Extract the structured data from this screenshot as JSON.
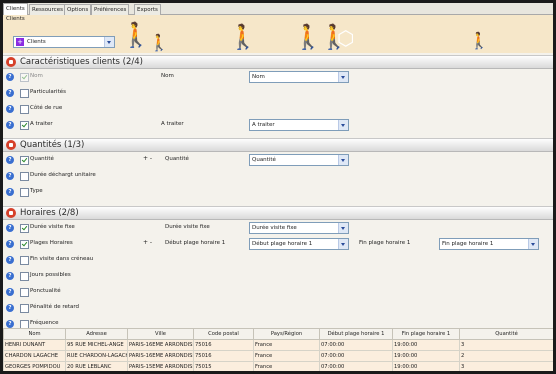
{
  "tabs": [
    {
      "label": "Clients"
    },
    {
      "label": "Ressources"
    },
    {
      "label": "Options"
    },
    {
      "label": "Préférences"
    },
    {
      "label": "Exports"
    }
  ],
  "header": {
    "label": "Clients",
    "select_value": "Clients",
    "accent": "#f0b000"
  },
  "sections": {
    "caracteristiques": "Caractéristiques clients (2/4)",
    "quantites": "Quantités (1/3)",
    "horaires": "Horaires (2/8)"
  },
  "rows": {
    "nom": {
      "label": "Nom",
      "label2": "Nom",
      "select": "Nom"
    },
    "particularites": {
      "label": "Particularités"
    },
    "cote_de_rue": {
      "label": "Côté de rue"
    },
    "a_traiter": {
      "label": "A traiter",
      "label2": "A traiter",
      "select": "A traiter"
    },
    "quantite": {
      "label": "Quantité",
      "pm": "+ -",
      "label2": "Quantité",
      "select": "Quantité"
    },
    "duree_dechargement": {
      "label": "Durée déchargt unitaire"
    },
    "type": {
      "label": "Type"
    },
    "duree_visite_fixe": {
      "label": "Durée visite fixe",
      "label2": "Durée visite fixe",
      "select": "Durée visite fixe"
    },
    "plages_horaires": {
      "label": "Plages Horaires",
      "pm": "+ -",
      "label2": "Début plage horaire 1",
      "select": "Début plage horaire 1",
      "label3": "Fin plage horaire 1",
      "select2": "Fin plage horaire 1"
    },
    "fin_visite": {
      "label": "Fin visite dans créneau"
    },
    "jours_possibles": {
      "label": "Jours possibles"
    },
    "ponctualite": {
      "label": "Ponctualité"
    },
    "penalite": {
      "label": "Pénalité de retard"
    },
    "frequence": {
      "label": "Fréquence"
    }
  },
  "table": {
    "columns": [
      "Nom",
      "Adresse",
      "Ville",
      "Code postal",
      "Pays/Région",
      "Début plage horaire 1",
      "Fin plage horaire 1",
      "Quantité"
    ],
    "rows": [
      [
        "HENRI DUNANT",
        "95 RUE MICHEL-ANGE",
        "PARIS-16EME ARRONDISSEMENT",
        "75016",
        "France",
        "07:00:00",
        "19:00:00",
        "3"
      ],
      [
        "CHARDON LAGACHE",
        "RUE CHARDON-LAGACHE",
        "PARIS-16EME ARRONDISSEMENT",
        "75016",
        "France",
        "07:00:00",
        "19:00:00",
        "2"
      ],
      [
        "GEORGES POMPIDOU",
        "20 RUE LEBLANC",
        "PARIS-15EME ARRONDISSEMENT",
        "75015",
        "France",
        "07:00:00",
        "19:00:00",
        "3"
      ]
    ]
  }
}
